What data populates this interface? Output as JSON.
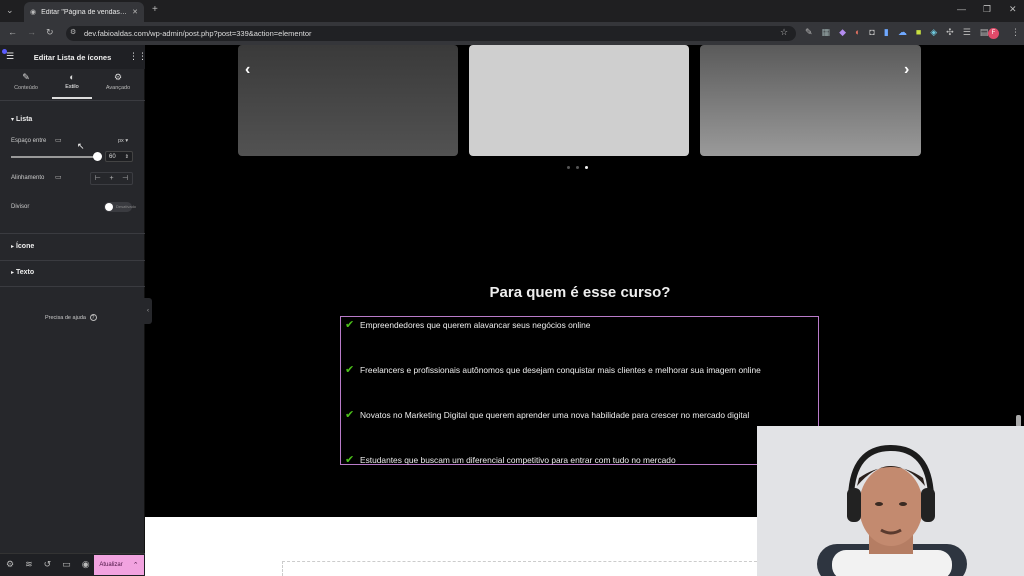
{
  "browser": {
    "tab_title": "Editar \"Página de vendas\" com",
    "url": "dev.fabioaldas.com/wp-admin/post.php?post=339&action=elementor"
  },
  "sidebar": {
    "title": "Editar Lista de ícones",
    "tabs": [
      {
        "label": "Conteúdo",
        "icon": "pencil-icon"
      },
      {
        "label": "Estilo",
        "icon": "contrast-icon"
      },
      {
        "label": "Avançado",
        "icon": "gear-icon"
      }
    ],
    "active_tab": "Estilo",
    "section_lista": "Lista",
    "espaco_label": "Espaço entre",
    "unit": "px",
    "espaco_value": "60",
    "alinhamento_label": "Alinhamento",
    "divisor_label": "Divisor",
    "divisor_toggle": "Desativado",
    "section_icone": "Ícone",
    "section_texto": "Texto",
    "help": "Precisa de ajuda",
    "update_button": "Atualizar"
  },
  "page": {
    "heading": "Para quem é esse curso?",
    "list_items": [
      "Empreendedores que querem alavancar seus negócios online",
      "Freelancers e profissionais autônomos que desejam conquistar mais clientes e melhorar sua imagem online",
      "Novatos no Marketing Digital que querem aprender uma nova habilidade para crescer no mercado digital",
      "Estudantes que buscam um diferencial competitivo para entrar com tudo no mercado"
    ],
    "carousel_dots_active": 3,
    "colors": {
      "check": "#4cc21a",
      "accent": "#f2a3e0",
      "list_border": "#b97bc9"
    }
  }
}
